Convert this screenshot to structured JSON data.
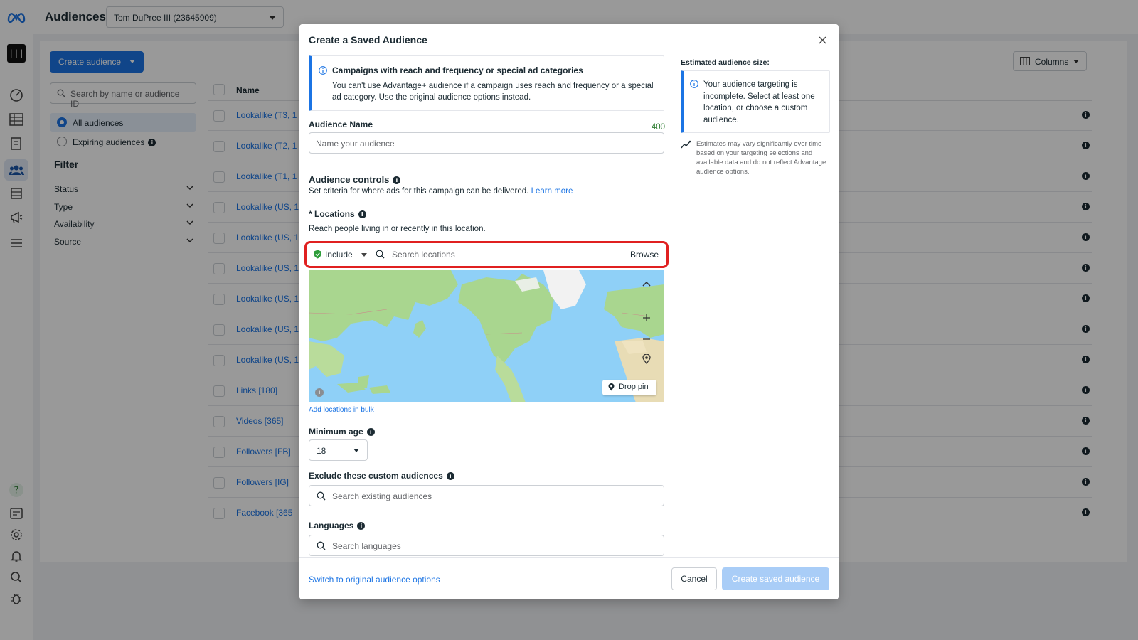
{
  "app": {
    "title": "Audiences",
    "account": "Tom DuPree III (23645909)",
    "brand_glyph": "|||"
  },
  "toolbar": {
    "create_label": "Create audience",
    "columns_label": "Columns"
  },
  "sidebar": {
    "search_placeholder": "Search by name or audience ID",
    "all_audiences": "All audiences",
    "expiring_audiences": "Expiring audiences",
    "filter_heading": "Filter",
    "filters": [
      "Status",
      "Type",
      "Availability",
      "Source"
    ]
  },
  "table": {
    "header_name": "Name",
    "rows": [
      "Lookalike (T3, 1",
      "Lookalike (T2, 1",
      "Lookalike (T1, 1",
      "Lookalike (US, 1",
      "Lookalike (US, 1",
      "Lookalike (US, 1",
      "Lookalike (US, 1",
      "Lookalike (US, 1",
      "Lookalike (US, 1",
      "Links [180]",
      "Videos [365]",
      "Followers [FB]",
      "Followers [IG]",
      "Facebook [365"
    ]
  },
  "modal": {
    "title": "Create a Saved Audience",
    "alert": {
      "heading": "Campaigns with reach and frequency or special ad categories",
      "body": "You can't use Advantage+ audience if a campaign uses reach and frequency or a special ad category. Use the original audience options instead."
    },
    "audience_name": {
      "label": "Audience Name",
      "counter": "400",
      "placeholder": "Name your audience"
    },
    "controls": {
      "heading": "Audience controls",
      "description": "Set criteria for where ads for this campaign can be delivered.",
      "learn_more": "Learn more"
    },
    "locations": {
      "label": "* Locations",
      "description": "Reach people living in or recently in this location.",
      "include_label": "Include",
      "search_placeholder": "Search locations",
      "browse_label": "Browse",
      "drop_pin_label": "Drop pin",
      "bulk_link": "Add locations in bulk"
    },
    "min_age": {
      "label": "Minimum age",
      "value": "18"
    },
    "exclude": {
      "label": "Exclude these custom audiences",
      "placeholder": "Search existing audiences"
    },
    "languages": {
      "label": "Languages",
      "placeholder": "Search languages"
    },
    "estimate": {
      "heading": "Estimated audience size:",
      "message": "Your audience targeting is incomplete. Select at least one location, or choose a custom audience.",
      "note": "Estimates may vary significantly over time based on your targeting selections and available data and do not reflect Advantage audience options."
    },
    "footer": {
      "switch_label": "Switch to original audience options",
      "cancel_label": "Cancel",
      "create_label": "Create saved audience"
    }
  },
  "colors": {
    "accent": "#1b74e4",
    "highlight_box": "#e02020",
    "counter_green": "#2e7d32",
    "include_shield": "#2e9d3a"
  }
}
